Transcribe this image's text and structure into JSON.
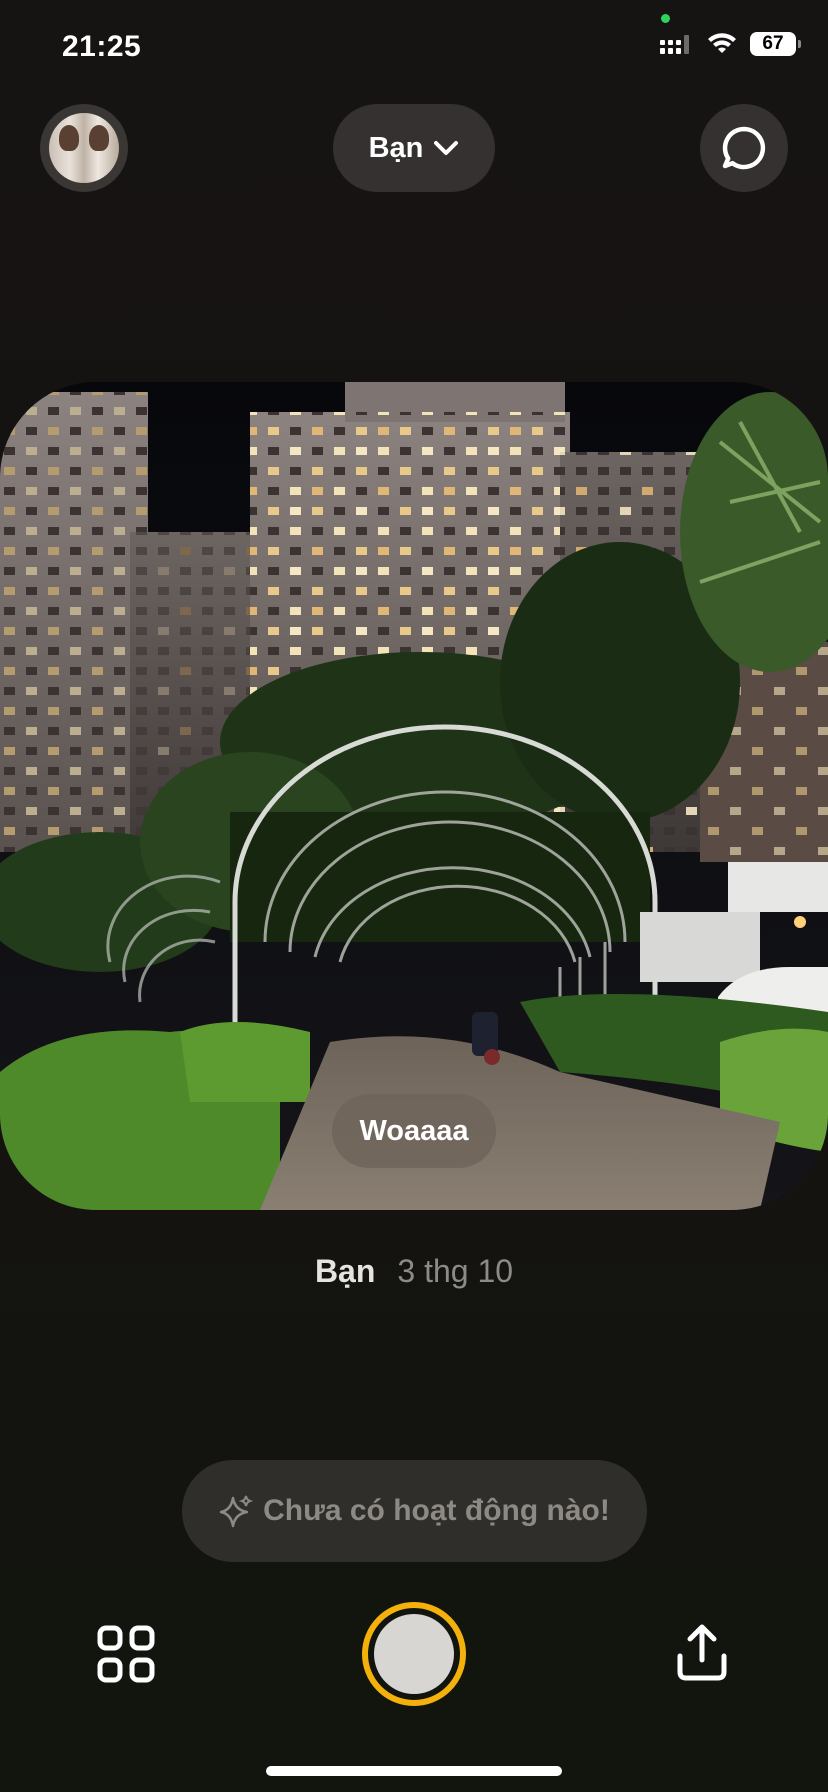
{
  "status_bar": {
    "time": "21:25",
    "battery": "67"
  },
  "header": {
    "friends_selector_label": "Bạn",
    "avatar_icon": "avatar-icon",
    "chat_icon": "chat-bubble-icon",
    "dropdown_icon": "chevron-down-icon"
  },
  "post": {
    "caption": "Woaaaa",
    "author": "Bạn",
    "date": "3 thg 10"
  },
  "activity": {
    "text": "Chưa có hoạt động nào!",
    "icon": "sparkle-icon"
  },
  "toolbar": {
    "grid_icon": "grid-icon",
    "shutter_icon": "shutter-button",
    "share_icon": "share-icon"
  },
  "colors": {
    "accent": "#f5b10b",
    "background": "#141210",
    "pill": "#353130"
  }
}
